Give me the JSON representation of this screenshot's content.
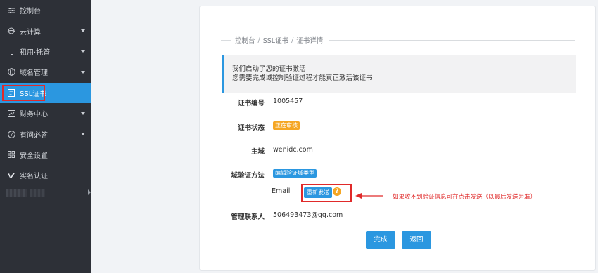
{
  "sidebar": {
    "items": [
      {
        "label": "控制台",
        "icon": "sliders-icon",
        "expandable": false
      },
      {
        "label": "云计算",
        "icon": "cloud-icon",
        "expandable": true
      },
      {
        "label": "租用·托管",
        "icon": "monitor-icon",
        "expandable": true
      },
      {
        "label": "域名管理",
        "icon": "globe-icon",
        "expandable": true
      },
      {
        "label": "SSL证书",
        "icon": "certificate-icon",
        "expandable": false,
        "active": true
      },
      {
        "label": "财务中心",
        "icon": "finance-icon",
        "expandable": true
      },
      {
        "label": "有问必答",
        "icon": "question-icon",
        "expandable": true
      },
      {
        "label": "安全设置",
        "icon": "grid-icon",
        "expandable": false
      },
      {
        "label": "实名认证",
        "icon": "vimeo-icon",
        "expandable": false
      }
    ]
  },
  "breadcrumb": [
    "控制台",
    "SSL证书",
    "证书详情"
  ],
  "notice": {
    "line1": "我们启动了您的证书激活",
    "line2": "您需要完成域控制验证过程才能真正激活该证书"
  },
  "details": {
    "cert_no_label": "证书编号",
    "cert_no_value": "1005457",
    "status_label": "证书状态",
    "status_value": "正在审核",
    "domain_label": "主域",
    "domain_value": "wenidc.com",
    "verify_label": "域验证方法",
    "verify_edit": "编辑验证域类型",
    "email_label": "Email",
    "resend_label": "重新发送",
    "help_glyph": "?",
    "contact_label": "管理联系人",
    "contact_value": "506493473@qq.com"
  },
  "annotation": "如果收不到验证信息可在点击发送（以最后发送为准）",
  "actions": {
    "done_label": "完成",
    "back_label": "返回"
  },
  "colors": {
    "sidebar_bg": "#2d3037",
    "accent": "#2b97e0",
    "warning": "#f5a623",
    "highlight_red": "#e02a2a"
  }
}
